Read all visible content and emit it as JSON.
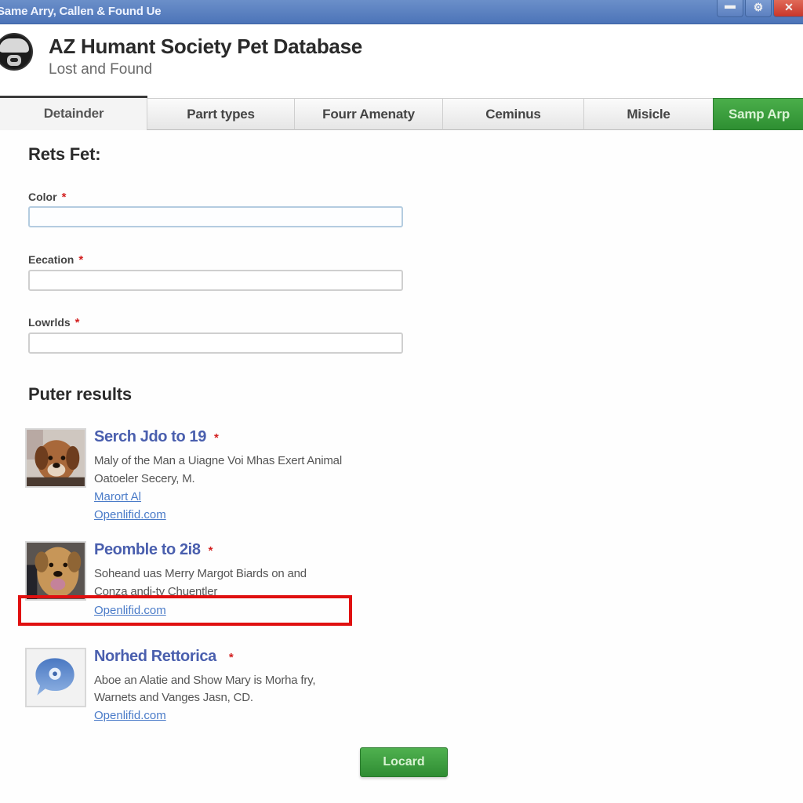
{
  "window": {
    "title": "Same Arry, Callen & Found Ue",
    "controls": [
      {
        "name": "minimize",
        "icon": "minimize-icon",
        "glyph": "▬"
      },
      {
        "name": "maximize",
        "icon": "gear-icon",
        "glyph": "⚙"
      },
      {
        "name": "close",
        "icon": "close-icon",
        "glyph": "✕"
      }
    ]
  },
  "header": {
    "logo_icon": "dog-logo-icon",
    "title": "AZ Humant Society Pet Database",
    "subtitle": "Lost and Found"
  },
  "tabs": [
    {
      "label": "Detainder",
      "active": true
    },
    {
      "label": "Parrt types",
      "active": false
    },
    {
      "label": "Fourr Amenaty",
      "active": false
    },
    {
      "label": "Cеminus",
      "active": false
    },
    {
      "label": "Misicle",
      "active": false
    },
    {
      "label": "Samp Arp",
      "active": false,
      "style": "green"
    }
  ],
  "form": {
    "heading": "Rets Fet:",
    "fields": [
      {
        "label": "Color",
        "required": true,
        "value": "",
        "placeholder": ""
      },
      {
        "label": "Eecation",
        "required": true,
        "value": "",
        "placeholder": ""
      },
      {
        "label": "Lowrlds",
        "required": true,
        "value": "",
        "placeholder": ""
      }
    ],
    "required_marker": "*"
  },
  "results": {
    "heading": "Puter results",
    "items": [
      {
        "thumb": "puppy-photo",
        "title": "Serch Jdo to 19",
        "required": true,
        "desc_lines": [
          "Maly of the Man a Uiagne Voi Mhas Exert Animal",
          "Oatoeler Secery, M."
        ],
        "links": [
          "Marort Al",
          "Openlifid.com"
        ]
      },
      {
        "thumb": "dog-photo",
        "title": "Peomble to 2i8",
        "required": true,
        "desc_lines": [
          "Soheand uas Merry Margot Biards on and",
          "Conza andi-ty Chuentler"
        ],
        "links": [
          "Openlifid.com"
        ],
        "highlighted_link": true
      },
      {
        "thumb": "chat-bubble-icon",
        "title": "Norhed Rettorica",
        "required": true,
        "desc_lines": [
          "Aboe an Alatie and Show Mary is Morha fry,",
          "Warnets and Vanges Jasn, CD."
        ],
        "links": [
          "Openlifid.com"
        ]
      }
    ]
  },
  "load_button": {
    "label": "Locard"
  },
  "colors": {
    "titlebar": "#5a80c0",
    "accent_green": "#3a9e3c",
    "link_blue": "#4a7bc8",
    "result_title": "#4a5fae",
    "required_red": "#d32020",
    "highlight_red": "#e01010"
  }
}
